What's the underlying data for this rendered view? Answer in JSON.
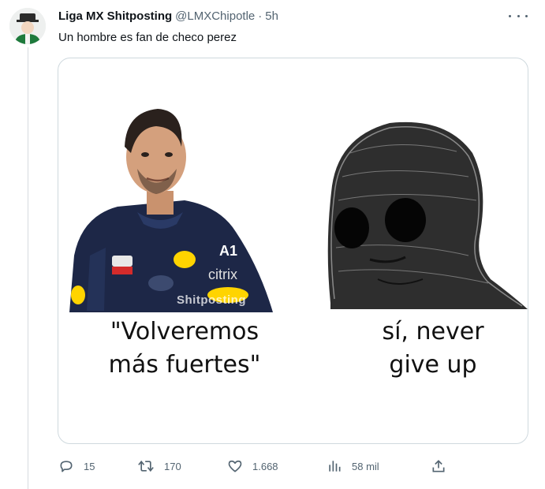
{
  "tweet": {
    "display_name": "Liga MX Shitposting",
    "handle": "@LMXChipotle",
    "separator": "·",
    "time": "5h",
    "text": "Un hombre es fan de checo perez"
  },
  "media": {
    "left_caption_line1": "\"Volveremos",
    "left_caption_line2": "más fuertes\"",
    "right_caption_line1": "sí, never",
    "right_caption_line2": "give up",
    "watermark": "Shitposting"
  },
  "actions": {
    "reply_count": "15",
    "retweet_count": "170",
    "like_count": "1.668",
    "views_count": "58 mil"
  },
  "icons": {
    "avatar": "avatar-icon",
    "more": "more-icon",
    "reply": "reply-icon",
    "retweet": "retweet-icon",
    "like": "heart-icon",
    "views": "views-icon",
    "share": "share-icon"
  },
  "colors": {
    "text_primary": "#0f1419",
    "text_secondary": "#536471",
    "border": "#cfd9de"
  }
}
